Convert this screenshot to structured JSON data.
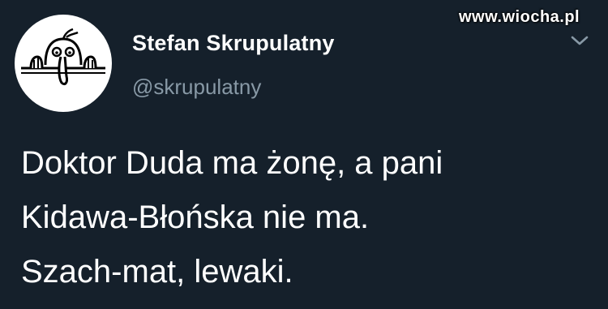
{
  "tweet": {
    "display_name": "Stefan Skrupulatny",
    "handle": "@skrupulatny",
    "text_lines": [
      "Doktor Duda ma żonę, a pani",
      "Kidawa-Błońska nie ma.",
      "Szach-mat, lewaki."
    ],
    "menu_icon": "chevron-down-icon",
    "avatar_icon": "kilroy-doodle-avatar"
  },
  "watermark": {
    "text": "www.wiocha.pl"
  },
  "colors": {
    "background": "#15202b",
    "primary_text": "#ffffff",
    "secondary_text": "#8899a6",
    "chevron": "#8899a6"
  }
}
